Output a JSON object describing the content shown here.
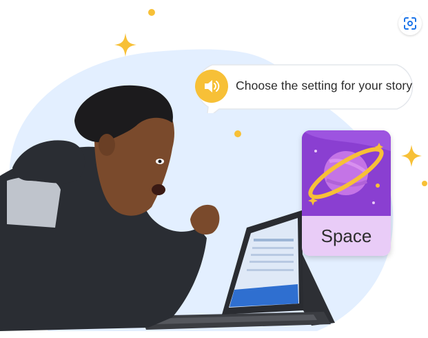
{
  "prompt": {
    "text": "Choose the setting for your story"
  },
  "card": {
    "label": "Space"
  },
  "colors": {
    "blob": "#e3efff",
    "star": "#f7c037",
    "speaker": "#f7c037",
    "card_art": "#8a3fd1",
    "card_footer": "#e9ccf7"
  },
  "icons": {
    "lens": "lens-icon",
    "speaker": "speaker-icon",
    "planet": "planet-icon",
    "sparkle": "sparkle-icon"
  }
}
